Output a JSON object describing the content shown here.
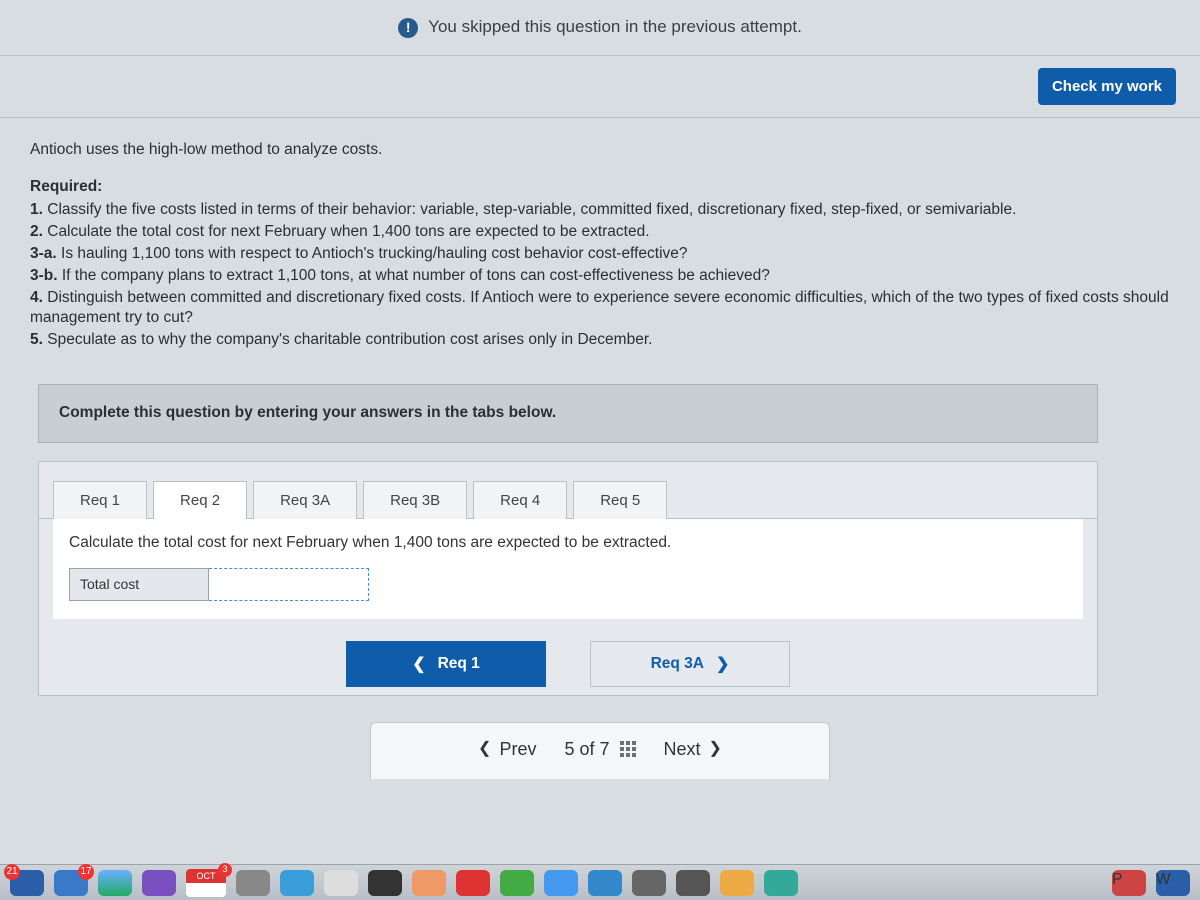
{
  "skipped_message": "You skipped this question in the previous attempt.",
  "check_button": "Check my work",
  "problem": {
    "intro": "Antioch uses the high-low method to analyze costs.",
    "required_label": "Required:",
    "items": {
      "n1": "1.",
      "t1": " Classify the five costs listed in terms of their behavior: variable, step-variable, committed fixed, discretionary fixed, step-fixed, or semivariable.",
      "n2": "2.",
      "t2": " Calculate the total cost for next February when 1,400 tons are expected to be extracted.",
      "n3a": "3-a.",
      "t3a": " Is hauling 1,100 tons with respect to Antioch's trucking/hauling cost behavior cost-effective?",
      "n3b": "3-b.",
      "t3b": " If the company plans to extract 1,100 tons, at what number of tons can cost-effectiveness be achieved?",
      "n4": "4.",
      "t4": " Distinguish between committed and discretionary fixed costs. If Antioch were to experience severe economic difficulties, which of the two types of fixed costs should management try to cut?",
      "n5": "5.",
      "t5": " Speculate as to why the company's charitable contribution cost arises only in December."
    }
  },
  "instruction": "Complete this question by entering your answers in the tabs below.",
  "tabs": {
    "t1": "Req 1",
    "t2": "Req 2",
    "t3a": "Req 3A",
    "t3b": "Req 3B",
    "t4": "Req 4",
    "t5": "Req 5"
  },
  "active_tab_prompt": "Calculate the total cost for next February when 1,400 tons are expected to be extracted.",
  "total_cost_label": "Total cost",
  "total_cost_value": "",
  "req_nav": {
    "prev": "Req 1",
    "next": "Req 3A"
  },
  "question_nav": {
    "prev": "Prev",
    "counter": "5 of 7",
    "next": "Next"
  },
  "dock": {
    "badge21": "21",
    "badge17": "17",
    "cal_badge": "3",
    "cal_month": "OCT",
    "cal_day": ""
  }
}
